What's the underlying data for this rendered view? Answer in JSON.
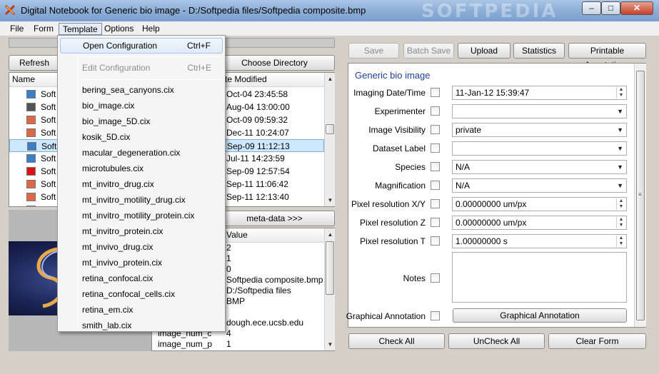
{
  "window": {
    "title": "Digital Notebook for Generic bio image - D:/Softpedia files/Softpedia composite.bmp",
    "watermark": "SOFTPEDIA",
    "minimize": "–",
    "maximize": "□",
    "close": "✕"
  },
  "menubar": [
    "File",
    "Form",
    "Template",
    "Options",
    "Help"
  ],
  "left": {
    "refresh": "Refresh",
    "choose_dir": "Choose Directory",
    "file_list": {
      "col_name": "Name",
      "col_modified": "te Modified",
      "names": [
        "Soft",
        "Soft",
        "Soft",
        "Soft",
        "Soft",
        "Soft",
        "Soft",
        "Soft",
        "Soft",
        "Soft"
      ],
      "modified": [
        "Oct-04 23:45:58",
        "Aug-04 13:00:00",
        "Oct-09 09:59:32",
        "Dec-11 10:24:07",
        "Sep-09 11:12:13",
        "Jul-11 14:23:59",
        "Sep-09 12:57:54",
        "Sep-11 11:06:42",
        "Sep-11 12:13:40"
      ]
    },
    "meta_button": "meta-data >>>",
    "meta_table": {
      "col_value": "Value",
      "values": [
        "2",
        "1",
        "0",
        "Softpedia composite.bmp",
        "D:/Softpedia files",
        "BMP",
        "",
        "dough.ece.ucsb.edu",
        "4",
        "1"
      ],
      "visible_keys": [
        "image_num_c",
        "image_num_p"
      ]
    }
  },
  "toolbar": {
    "save": "Save",
    "batch_save": "Batch Save",
    "upload": "Upload",
    "statistics": "Statistics",
    "printable": "Printable Annotations"
  },
  "form": {
    "heading": "Generic bio image",
    "imaging_date_label": "Imaging Date/Time",
    "imaging_date_value": "11-Jan-12 15:39:47",
    "experimenter_label": "Experimenter",
    "experimenter_value": "",
    "visibility_label": "Image Visibility",
    "visibility_value": "private",
    "dataset_label": "Dataset Label",
    "dataset_value": "",
    "species_label": "Species",
    "species_value": "N/A",
    "magnification_label": "Magnification",
    "magnification_value": "N/A",
    "pxy_label": "Pixel resolution X/Y",
    "pxy_value": "0.00000000 um/px",
    "pz_label": "Pixel resolution Z",
    "pz_value": "0.00000000 um/px",
    "pt_label": "Pixel resolution T",
    "pt_value": "1.00000000 s",
    "notes_label": "Notes",
    "graphical_label": "Graphical Annotation",
    "graphical_button": "Graphical Annotation"
  },
  "bottom": {
    "check_all": "Check All",
    "uncheck_all": "UnCheck All",
    "clear_form": "Clear Form"
  },
  "template_menu": {
    "open": "Open Configuration",
    "open_shortcut": "Ctrl+F",
    "edit": "Edit Configuration",
    "edit_shortcut": "Ctrl+E",
    "items": [
      "bering_sea_canyons.cix",
      "bio_image.cix",
      "bio_image_5D.cix",
      "kosik_5D.cix",
      "macular_degeneration.cix",
      "microtubules.cix",
      "mt_invitro_drug.cix",
      "mt_invitro_motility_drug.cix",
      "mt_invitro_motility_protein.cix",
      "mt_invitro_protein.cix",
      "mt_invivo_drug.cix",
      "mt_invivo_protein.cix",
      "retina_confocal.cix",
      "retina_confocal_cells.cix",
      "retina_em.cix",
      "smith_lab.cix"
    ]
  }
}
